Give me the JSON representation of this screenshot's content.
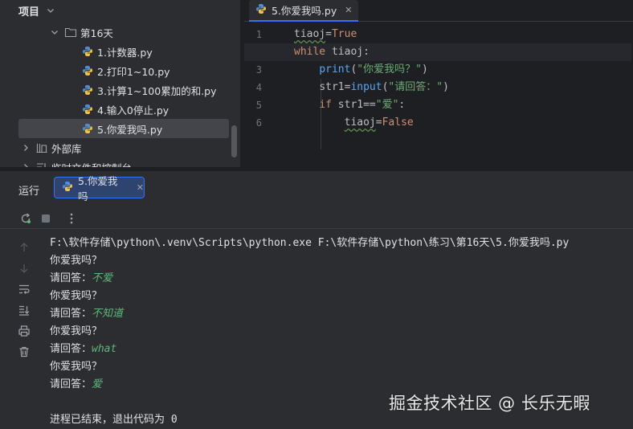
{
  "project": {
    "title": "项目",
    "tree": [
      {
        "label": "第16天",
        "type": "folder",
        "expanded": true
      },
      {
        "label": "1.计数器.py",
        "type": "python"
      },
      {
        "label": "2.打印1~10.py",
        "type": "python"
      },
      {
        "label": "3.计算1~100累加的和.py",
        "type": "python"
      },
      {
        "label": "4.输入0停止.py",
        "type": "python"
      },
      {
        "label": "5.你爱我吗.py",
        "type": "python",
        "selected": true
      },
      {
        "label": "外部库",
        "type": "library"
      },
      {
        "label": "临时文件和控制台",
        "type": "scratches"
      }
    ]
  },
  "editor": {
    "tab_label": "5.你爱我吗.py",
    "line_numbers": [
      "1",
      "2",
      "3",
      "4",
      "5",
      "6"
    ],
    "current_line": "2",
    "code": {
      "l1_a": "tiaoj",
      "l1_b": "=",
      "l1_c": "True",
      "l2_a": "while",
      "l2_b": " tiaoj:",
      "l3_indent": "    ",
      "l3_fn": "print",
      "l3_open": "(",
      "l3_str": "\"你爱我吗？\"",
      "l3_close": ")",
      "l4_indent": "    ",
      "l4_var": "str1=",
      "l4_fn": "input",
      "l4_open": "(",
      "l4_str": "\"请回答：\"",
      "l4_close": ")",
      "l5_indent": "    ",
      "l5_kw": "if",
      "l5_mid": " str1==",
      "l5_str": "\"爱\"",
      "l5_end": ":",
      "l6_indent": "        ",
      "l6_var": "tiaoj",
      "l6_eq": "=",
      "l6_val": "False"
    }
  },
  "run": {
    "title": "运行",
    "tab_label": "5.你爱我吗",
    "console": {
      "command": "F:\\软件存储\\python\\.venv\\Scripts\\python.exe F:\\软件存储\\python\\练习\\第16天\\5.你爱我吗.py",
      "q1": "你爱我吗？",
      "p1": "请回答：",
      "a1": "不爱",
      "q2": "你爱我吗？",
      "p2": "请回答：",
      "a2": "不知道",
      "q3": "你爱我吗？",
      "p3": "请回答：",
      "a3": "what",
      "q4": "你爱我吗？",
      "p4": "请回答：",
      "a4": "爱",
      "exit": "进程已结束，退出代码为 0"
    }
  },
  "watermark": "掘金技术社区 @ 长乐无暇",
  "colors": {
    "accent": "#3574f0",
    "keyword": "#cf8e6d",
    "function": "#56a8f5",
    "string": "#6aab73",
    "user_input": "#5fb87a"
  }
}
